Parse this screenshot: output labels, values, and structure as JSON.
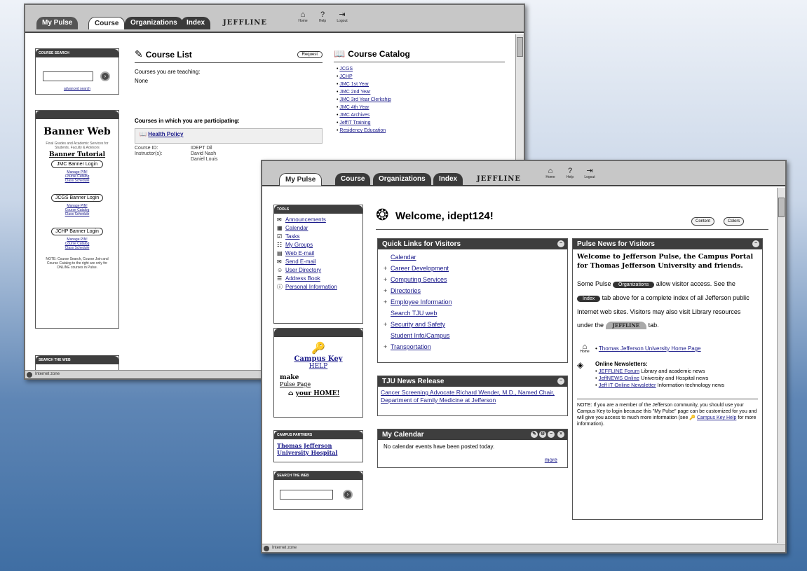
{
  "window1": {
    "tabs": [
      "My Pulse",
      "Course",
      "Organizations",
      "Index",
      "JEFFLINE"
    ],
    "toolbar_icons": [
      {
        "icon": "home-icon",
        "label": "Home"
      },
      {
        "icon": "help-icon",
        "label": "Help"
      },
      {
        "icon": "logout-icon",
        "label": "Logout"
      }
    ],
    "course_search": {
      "header": "Course Search",
      "link": "advanced search"
    },
    "banner": {
      "title": "Banner Web",
      "desc": "Final Grades and Academic Services for Students, Faculty & Advisors",
      "tutorial": "Banner Tutorial",
      "buttons": [
        {
          "label": "JMC Banner Login",
          "links": [
            "Manage PIN!",
            "Course Catalog",
            "Class Schedule"
          ]
        },
        {
          "label": "JCGS Banner Login",
          "links": [
            "Manage PIN!",
            "Course Catalog",
            "Class Schedule"
          ]
        },
        {
          "label": "JCHP Banner Login",
          "links": [
            "Manage PIN!",
            "Course Catalog",
            "Class Schedule"
          ]
        }
      ],
      "note": "NOTE: Course Search, Course Join and Course Catalog to the right are only for ONLINE courses in Pulse."
    },
    "search_web_header": "Search the Web",
    "course_list": {
      "title": "Course List",
      "button": "Request",
      "teaching_label": "Courses you are teaching:",
      "teaching_value": "None",
      "participating_label": "Courses in which you are participating:",
      "course_name": "Health Policy",
      "course_id_label": "Course ID:",
      "course_id": "IDEPT Dil",
      "instructors_label": "Instructor(s):",
      "instructors": [
        "David Nash",
        "Daniel Louis"
      ]
    },
    "course_catalog": {
      "title": "Course Catalog",
      "items": [
        "JCGS",
        "JCHP",
        "JMC 1st Year",
        "JMC 2nd Year",
        "JMC 3rd Year Clerkship",
        "JMC 4th Year",
        "JMC Archives",
        "JeffIT Training",
        "Residency Education"
      ]
    },
    "status": "Internet zone"
  },
  "window2": {
    "tabs": [
      "My Pulse",
      "Course",
      "Organizations",
      "Index",
      "JEFFLINE"
    ],
    "toolbar_icons": [
      {
        "icon": "home-icon",
        "label": "Home"
      },
      {
        "icon": "help-icon",
        "label": "Help"
      },
      {
        "icon": "logout-icon",
        "label": "Logout"
      }
    ],
    "tools": {
      "header": "Tools",
      "items": [
        "Announcements",
        "Calendar",
        "Tasks",
        "My Groups",
        "Web E-mail",
        "Send E-mail",
        "User Directory",
        "Address Book",
        "Personal Information"
      ]
    },
    "campus_key": {
      "title": "Campus Key",
      "help": "HELP",
      "make": "make",
      "page_label": "Pulse Page",
      "home": "your HOME!"
    },
    "partners": {
      "header": "Campus Partners",
      "link": "Thomas Jefferson University Hospital"
    },
    "search_web": {
      "header": "Search the Web"
    },
    "welcome": "Welcome, idept124!",
    "buttons": [
      "Content",
      "Colors"
    ],
    "quick_links": {
      "header": "Quick Links for Visitors",
      "items": [
        {
          "label": "Calendar",
          "plus": false
        },
        {
          "label": "Career Development",
          "plus": true
        },
        {
          "label": "Computing Services",
          "plus": true
        },
        {
          "label": "Directories",
          "plus": true
        },
        {
          "label": "Employee Information",
          "plus": true
        },
        {
          "label": "Search TJU web",
          "plus": false
        },
        {
          "label": "Security and Safety",
          "plus": true
        },
        {
          "label": "Student Info/Campus",
          "plus": false
        },
        {
          "label": "Transportation",
          "plus": true
        }
      ]
    },
    "news": {
      "header": "TJU News Release",
      "text": "Cancer Screening Advocate Richard Wender, M.D., Named Chair, Department of Family Medicine at Jefferson"
    },
    "calendar": {
      "header": "My Calendar",
      "text": "No calendar events have been posted today.",
      "more": "more"
    },
    "pulse_news": {
      "header": "Pulse News for Visitors",
      "intro": "Welcome to Jefferson Pulse, the Campus Portal for Thomas Jefferson University and friends.",
      "p1_a": "Some Pulse",
      "p1_org": "Organizations",
      "p1_b": "allow visitor",
      "p1_c": "access. See the",
      "p1_index": "Index",
      "p1_d": "tab above for a complete index of all Jefferson public Internet web sites. Visitors may also visit Library resources under the",
      "p1_jeffline": "JEFFLINE",
      "p1_e": "tab.",
      "home_link": "Thomas Jefferson University Home Page",
      "home_icon_label": "Home",
      "newsletters_title": "Online Newsletters:",
      "nl1_link": "JEFFLINE Forum",
      "nl1_text": "Library and academic news",
      "nl2_link": "JeffNEWS Online",
      "nl2_text": "University and Hospital news",
      "nl3_link": "Jeff IT Online Newsletter",
      "nl3_text": "Information technology news",
      "note_a": "NOTE: If you are a member of the Jefferson community, you should use your Campus Key to login because this \"My Pulse\" page can be customized for you and will give you access to much more information (see",
      "note_link": "Campus Key Help",
      "note_b": "for more information)."
    },
    "status": "Internet zone"
  }
}
